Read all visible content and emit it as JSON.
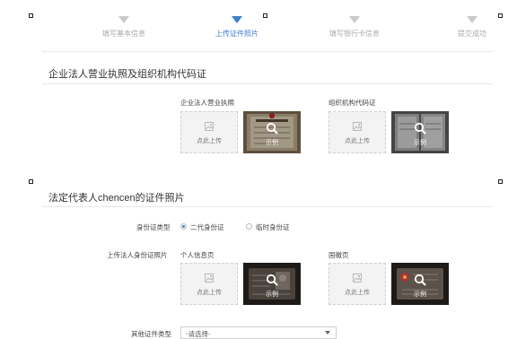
{
  "steps": [
    {
      "label": "填写基本信息",
      "active": false
    },
    {
      "label": "上传证件照片",
      "active": true
    },
    {
      "label": "填写银行卡信息",
      "active": false
    },
    {
      "label": "提交成功",
      "active": false
    }
  ],
  "section1": {
    "title": "企业法人营业执照及组织机构代码证",
    "license_label": "企业法人营业执照",
    "org_code_label": "组织机构代码证"
  },
  "section2": {
    "title": "法定代表人chencen的证件照片",
    "id_type_label": "身份证类型",
    "id_type_options": [
      "二代身份证",
      "临时身份证"
    ],
    "id_type_selected": "二代身份证",
    "upload_id_label": "上传法人身份证照片",
    "personal_page_label": "个人信息页",
    "emblem_page_label": "国徽页",
    "other_id_label": "其他证件类型",
    "other_id_select_value": "-请选择-"
  },
  "upload": {
    "click_upload": "点此上传",
    "sample": "示例"
  },
  "colors": {
    "accent": "#3d7fc8",
    "inactive_step": "#c9c9c9"
  }
}
